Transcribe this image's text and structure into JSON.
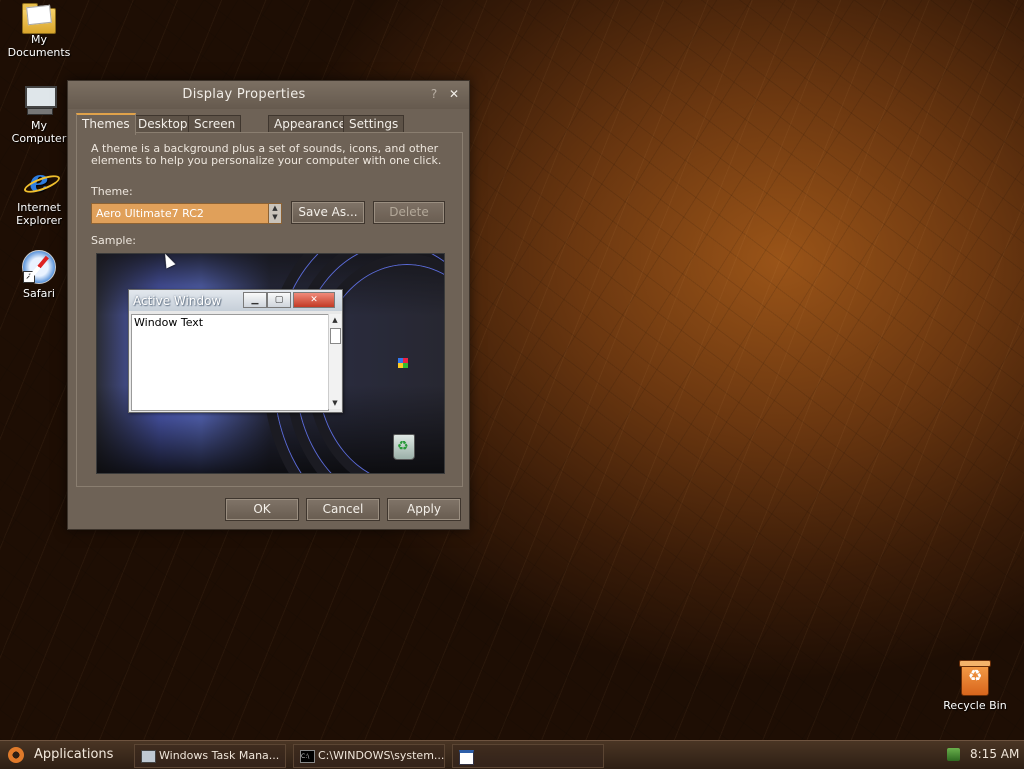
{
  "desktop": {
    "icons": [
      {
        "label": "My\nDocuments"
      },
      {
        "label": "My\nComputer"
      },
      {
        "label": "Internet\nExplorer"
      },
      {
        "label": "Safari"
      },
      {
        "label": "Recycle Bin"
      }
    ]
  },
  "dialog": {
    "title": "Display Properties",
    "help_glyph": "?",
    "close_glyph": "✕",
    "tabs": [
      {
        "label": "Themes",
        "active": true
      },
      {
        "label": "Desktop"
      },
      {
        "label": "Screen Saver"
      },
      {
        "label": "Appearance"
      },
      {
        "label": "Settings"
      }
    ],
    "description": "A theme is a background plus a set of sounds, icons, and other elements to help you personalize your computer with one click.",
    "theme_label": "Theme:",
    "theme_value": "Aero Ultimate7 RC2",
    "save_as_label": "Save As...",
    "delete_label": "Delete",
    "sample_label": "Sample:",
    "sample": {
      "window_title": "Active Window",
      "window_text": "Window Text"
    },
    "ok_label": "OK",
    "cancel_label": "Cancel",
    "apply_label": "Apply"
  },
  "taskbar": {
    "applications_label": "Applications",
    "tasks": [
      {
        "label": "Windows Task Mana..."
      },
      {
        "label": "C:\\WINDOWS\\system..."
      },
      {
        "label": ""
      }
    ],
    "clock": "8:15 AM"
  },
  "colors": {
    "accent": "#e0a24a",
    "dialog_bg": "#6e6256",
    "selected_theme_bg": "#e0a05a"
  }
}
